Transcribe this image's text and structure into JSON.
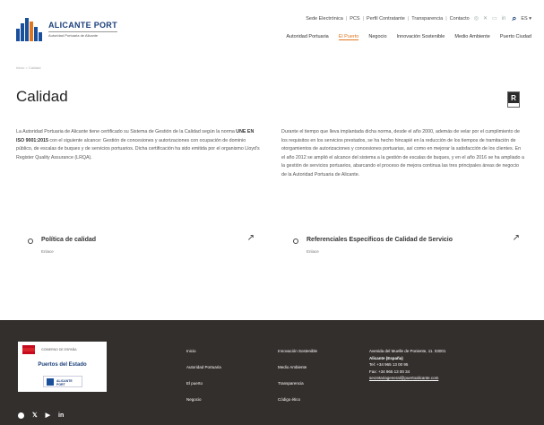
{
  "header": {
    "logo_title": "ALICANTE PORT",
    "logo_sub": "Autoridad Portuaria de Alicante",
    "top_links": [
      "Sede Electrónica",
      "PCS",
      "Perfil Contratante",
      "Transparencia",
      "Contacto"
    ],
    "search_icon": "search-icon",
    "lang": "ES",
    "main_nav": [
      "Autoridad Portuaria",
      "El Puerto",
      "Negocio",
      "Innovación Sostenible",
      "Medio Ambiente",
      "Puerto Ciudad"
    ],
    "active_nav": "El Puerto"
  },
  "breadcrumb": "Inicio > Calidad",
  "page": {
    "title": "Calidad",
    "badge": "R",
    "left_text_1": "La Autoridad Portuaria de Alicante tiene certificado su Sistema de Gestión de la Calidad según la norma ",
    "left_text_bold": "UNE EN ISO 9001:2015",
    "left_text_2": " con el siguiente alcance: Gestión de concesiones y autorizaciones con ocupación de dominio público, de escalas de buques y de servicios portuarios. Dicha certificación ha sido emitida por el organismo Lloyd's Register Quality Assurance (LRQA).",
    "right_text": "Durante el tiempo que lleva implantada dicha norma, desde el año 2000, además de velar por el cumplimiento de los requisitos en los servicios prestados, se ha hecho hincapié en la reducción de los tiempos de tramitación de otorgamientos de autorizaciones y concesiones portuarias, así como en mejorar la satisfacción de los clientes. En el año 2012 se amplió el alcance del sistema a la gestión de escalas de buques, y en el año 2016 se ha ampliado a la gestión de servicios portuarios, abarcando el proceso de mejora continua las tres principales áreas de negocio de la Autoridad Portuaria de Alicante."
  },
  "cards": [
    {
      "title": "Política de calidad",
      "link": "Enlace"
    },
    {
      "title": "Referenciales Específicos de Calidad de Servicio",
      "link": "Enlace"
    }
  ],
  "footer": {
    "ministry": "GOBIERNO DE ESPAÑA",
    "puertos": "Puertos del Estado",
    "port_logo": "ALICANTE PORT",
    "col1": [
      "Inicio",
      "Autoridad Portuaria",
      "El puerto",
      "Negocio"
    ],
    "col2": [
      "Innovación Sostenible",
      "Medio Ambiente",
      "Transparencia",
      "Código ético"
    ],
    "address": "Avenida del Muelle de Poniente, 11. 03001",
    "city": "Alicante (España)",
    "tel": "Tel: +34 965 13 00 95",
    "fax": "Fax: +34 965 13 00 34",
    "email": "secretariageneral@puertoalicante.com"
  }
}
